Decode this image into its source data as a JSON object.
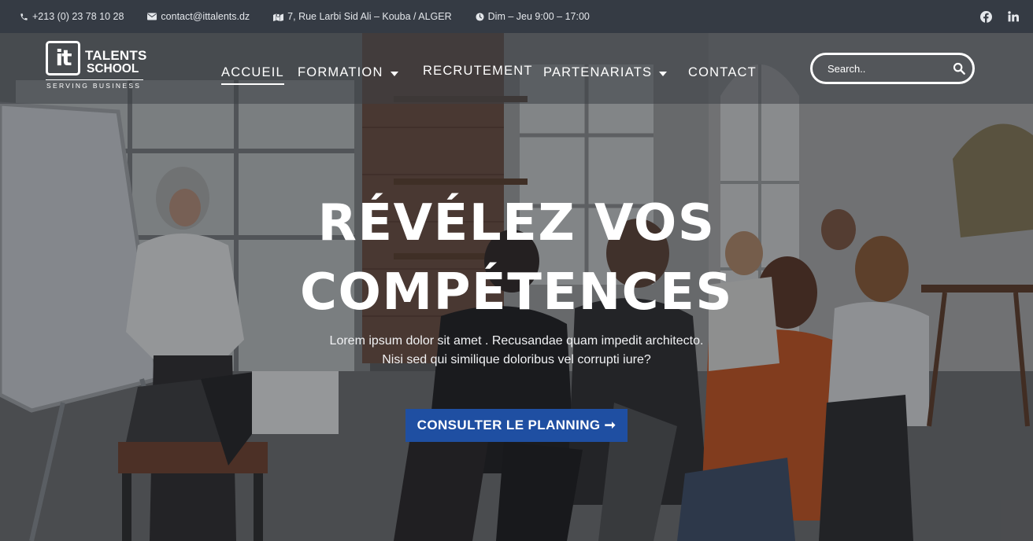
{
  "topbar": {
    "phone": "+213 (0) 23 78 10 28",
    "email": "contact@ittalents.dz",
    "address": "7, Rue Larbi Sid Ali – Kouba / ALGER",
    "hours": "Dim – Jeu 9:00 – 17:00",
    "social": [
      "facebook-icon",
      "linkedin-icon"
    ]
  },
  "logo": {
    "mark": "it",
    "line1": "TALENTS",
    "line2": "SCHOOL",
    "tagline": "SERVING BUSINESS"
  },
  "nav": {
    "items": [
      {
        "label": "ACCUEIL",
        "active": true,
        "dropdown": false
      },
      {
        "label": "FORMATION",
        "active": false,
        "dropdown": true
      },
      {
        "label": "RECRUTEMENT",
        "active": false,
        "dropdown": false
      },
      {
        "label": "PARTENARIATS",
        "active": false,
        "dropdown": true
      },
      {
        "label": "CONTACT",
        "active": false,
        "dropdown": false
      }
    ]
  },
  "search": {
    "placeholder": "Search.."
  },
  "hero": {
    "title_line1": "RÉVÉLEZ VOS",
    "title_line2": "COMPÉTENCES",
    "subtitle": "Lorem ipsum dolor sit amet . Recusandae quam impedit architecto. Nisi sed qui similique doloribus vel corrupti iure?",
    "cta": "CONSULTER LE PLANNING ➞"
  },
  "colors": {
    "topbar_bg": "#353b44",
    "cta_bg": "#1f4fa2",
    "text": "#ffffff"
  }
}
